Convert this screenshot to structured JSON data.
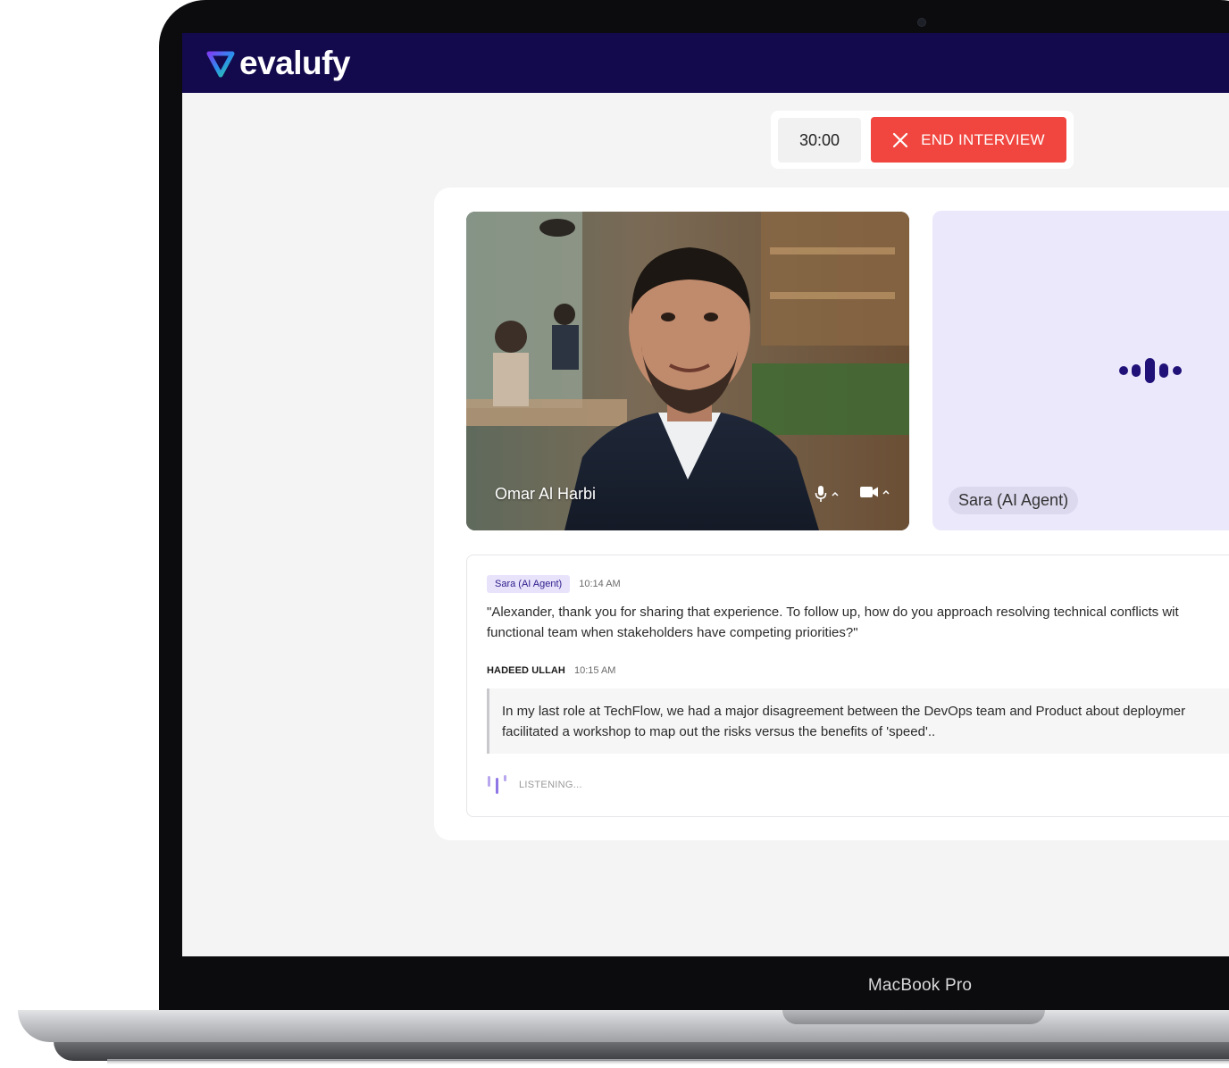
{
  "app": {
    "brand": "evalufy"
  },
  "device": {
    "model_label": "MacBook Pro"
  },
  "controls": {
    "timer": "30:00",
    "end_button": "END INTERVIEW"
  },
  "participants": {
    "candidate": {
      "name": "Omar Al Harbi"
    },
    "agent": {
      "name": "Sara (AI Agent)"
    }
  },
  "transcript": {
    "messages": [
      {
        "speaker": "Sara (AI Agent)",
        "time": "10:14 AM",
        "lines": [
          "\"Alexander, thank you for sharing that experience. To follow up, how do you approach resolving technical conflicts wit",
          "functional team when stakeholders have competing priorities?\""
        ]
      },
      {
        "speaker": "HADEED ULLAH",
        "time": "10:15 AM",
        "lines": [
          "In my last role at TechFlow, we had a major disagreement between the DevOps team and Product about deploymer",
          "facilitated a workshop to map out the risks versus the benefits of 'speed'.."
        ]
      }
    ],
    "status": "LISTENING..."
  },
  "colors": {
    "topbar": "#130a4e",
    "end_button": "#f0463f",
    "agent_tile": "#ebe8fb",
    "accent": "#2d1a8a"
  }
}
